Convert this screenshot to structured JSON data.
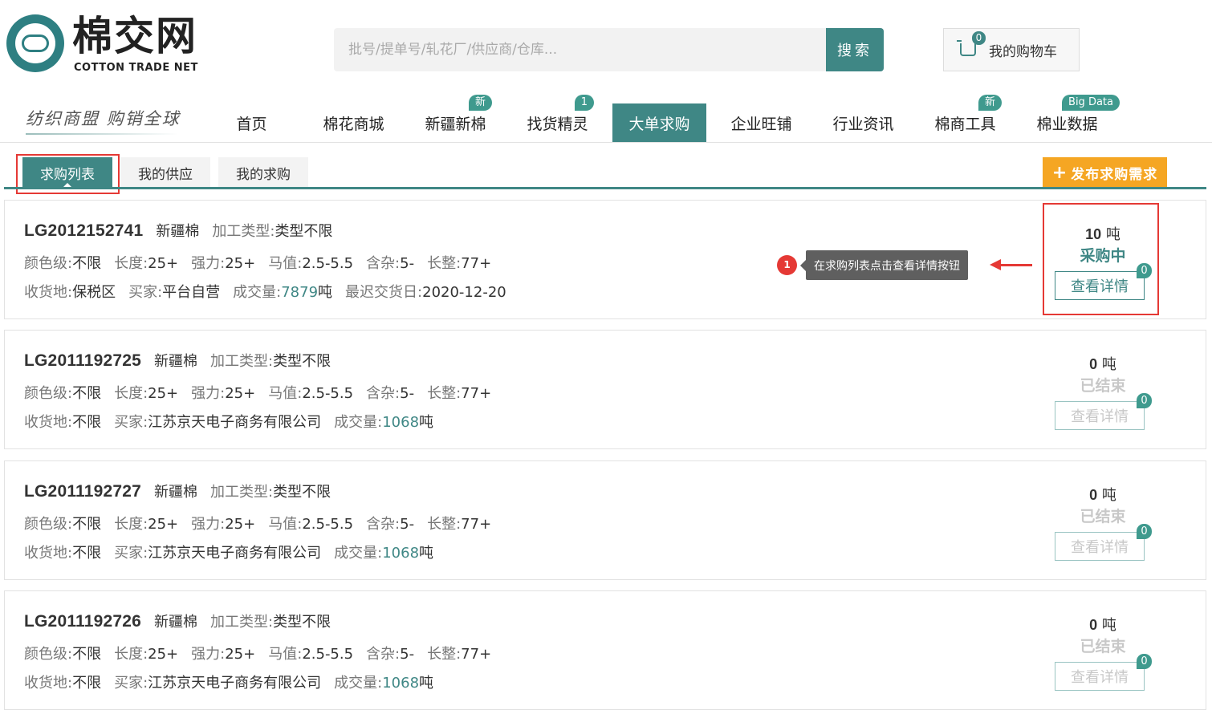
{
  "brand": {
    "title": "棉交网",
    "subtitle": "COTTON TRADE NET",
    "slogan": "纺织商盟 购销全球"
  },
  "search": {
    "placeholder": "批号/提单号/轧花厂/供应商/仓库...",
    "button_label": "搜索"
  },
  "cart": {
    "label": "我的购物车",
    "count": "0",
    "icon": "cart-icon"
  },
  "nav": {
    "items": [
      {
        "label": "首页",
        "badge": ""
      },
      {
        "label": "棉花商城",
        "badge": ""
      },
      {
        "label": "新疆新棉",
        "badge": "新"
      },
      {
        "label": "找货精灵",
        "badge": "1"
      },
      {
        "label": "大单求购",
        "badge": "",
        "active": true
      },
      {
        "label": "企业旺铺",
        "badge": ""
      },
      {
        "label": "行业资讯",
        "badge": ""
      },
      {
        "label": "棉商工具",
        "badge": "新"
      },
      {
        "label": "棉业数据",
        "badge": "Big Data"
      }
    ]
  },
  "subtabs": {
    "items": [
      "求购列表",
      "我的供应",
      "我的求购"
    ],
    "active": "求购列表",
    "publish_label": "发布求购需求",
    "publish_icon": "plus-icon"
  },
  "annotation": {
    "step": "1",
    "text": "在求购列表点击查看详情按钮"
  },
  "labels": {
    "color_grade": "颜色级:",
    "length": "长度:",
    "strength": "强力:",
    "micronaire": "马值:",
    "impurity": "含杂:",
    "uniformity": "长整:",
    "delivery": "收货地:",
    "buyer": "买家:",
    "volume": "成交量:",
    "latest_date": "最迟交货日:",
    "process_type": "加工类型:",
    "unit": "吨",
    "detail": "查看详情"
  },
  "requests": [
    {
      "id": "LG2012152741",
      "origin": "新疆棉",
      "process": "类型不限",
      "color": "不限",
      "length": "25+",
      "strength": "25+",
      "mic": "2.5-5.5",
      "impurity": "5-",
      "uniformity": "77+",
      "delivery": "保税区",
      "buyer": "平台自营",
      "volume": "7879",
      "volume_unit": "吨",
      "latest_date": "2020-12-20",
      "qty": "10",
      "status": "采购中",
      "status_state": "on",
      "detail_badge": "0"
    },
    {
      "id": "LG2011192725",
      "origin": "新疆棉",
      "process": "类型不限",
      "color": "不限",
      "length": "25+",
      "strength": "25+",
      "mic": "2.5-5.5",
      "impurity": "5-",
      "uniformity": "77+",
      "delivery": "不限",
      "buyer": "江苏京天电子商务有限公司",
      "volume": "1068",
      "volume_unit": "吨",
      "latest_date": "",
      "qty": "0",
      "status": "已结束",
      "status_state": "off",
      "detail_badge": "0"
    },
    {
      "id": "LG2011192727",
      "origin": "新疆棉",
      "process": "类型不限",
      "color": "不限",
      "length": "25+",
      "strength": "25+",
      "mic": "2.5-5.5",
      "impurity": "5-",
      "uniformity": "77+",
      "delivery": "不限",
      "buyer": "江苏京天电子商务有限公司",
      "volume": "1068",
      "volume_unit": "吨",
      "latest_date": "",
      "qty": "0",
      "status": "已结束",
      "status_state": "off",
      "detail_badge": "0"
    },
    {
      "id": "LG2011192726",
      "origin": "新疆棉",
      "process": "类型不限",
      "color": "不限",
      "length": "25+",
      "strength": "25+",
      "mic": "2.5-5.5",
      "impurity": "5-",
      "uniformity": "77+",
      "delivery": "不限",
      "buyer": "江苏京天电子商务有限公司",
      "volume": "1068",
      "volume_unit": "吨",
      "latest_date": "",
      "qty": "0",
      "status": "已结束",
      "status_state": "off",
      "detail_badge": "0"
    }
  ],
  "colors": {
    "brand": "#3f8785",
    "accent": "#f5a623",
    "alert": "#e53935"
  }
}
